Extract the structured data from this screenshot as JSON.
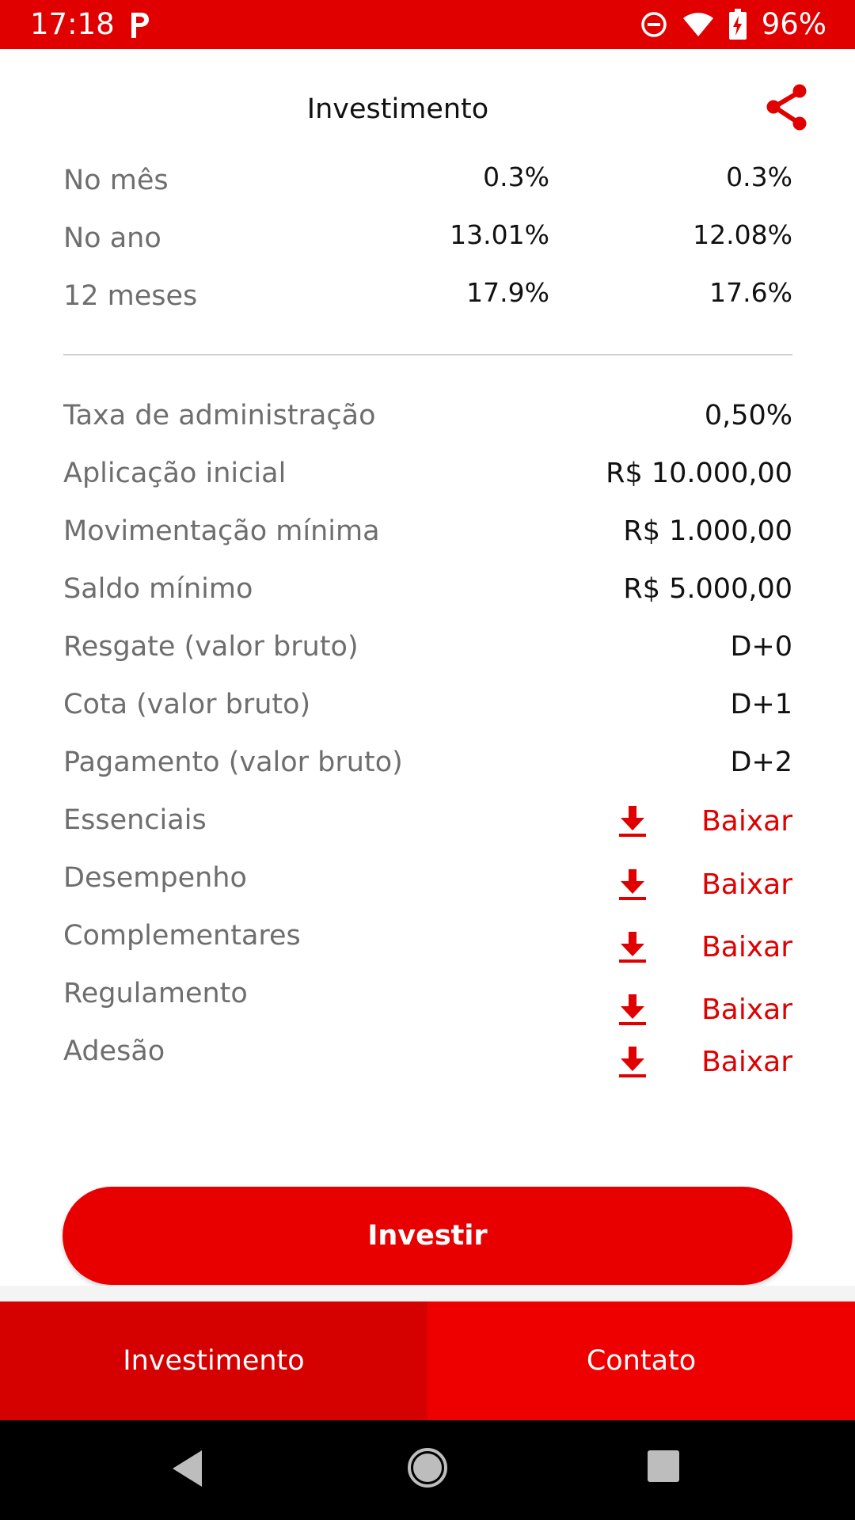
{
  "status_bar": {
    "time": "17:18",
    "battery_percent": "96%"
  },
  "header": {
    "title": "Investimento"
  },
  "performance": [
    {
      "label": "No mês",
      "value1": "0.3%",
      "value2": "0.3%"
    },
    {
      "label": "No ano",
      "value1": "13.01%",
      "value2": "12.08%"
    },
    {
      "label": "12 meses",
      "value1": "17.9%",
      "value2": "17.6%"
    }
  ],
  "details": [
    {
      "label": "Taxa de administração",
      "value": "0,50%"
    },
    {
      "label": "Aplicação inicial",
      "value": "R$ 10.000,00"
    },
    {
      "label": "Movimentação mínima",
      "value": "R$ 1.000,00"
    },
    {
      "label": "Saldo mínimo",
      "value": "R$ 5.000,00"
    },
    {
      "label": "Resgate (valor bruto)",
      "value": "D+0"
    },
    {
      "label": "Cota (valor bruto)",
      "value": "D+1"
    },
    {
      "label": "Pagamento (valor bruto)",
      "value": "D+2"
    }
  ],
  "documents": [
    {
      "label": "Essenciais",
      "action": "Baixar"
    },
    {
      "label": "Desempenho",
      "action": "Baixar"
    },
    {
      "label": "Complementares",
      "action": "Baixar"
    },
    {
      "label": "Regulamento",
      "action": "Baixar"
    },
    {
      "label": "Adesão",
      "action": "Baixar"
    }
  ],
  "invest_button": "Investir",
  "tabs": [
    {
      "label": "Investimento"
    },
    {
      "label": "Contato"
    }
  ],
  "colors": {
    "accent": "#e00000",
    "label_gray": "#6e6e6e"
  }
}
